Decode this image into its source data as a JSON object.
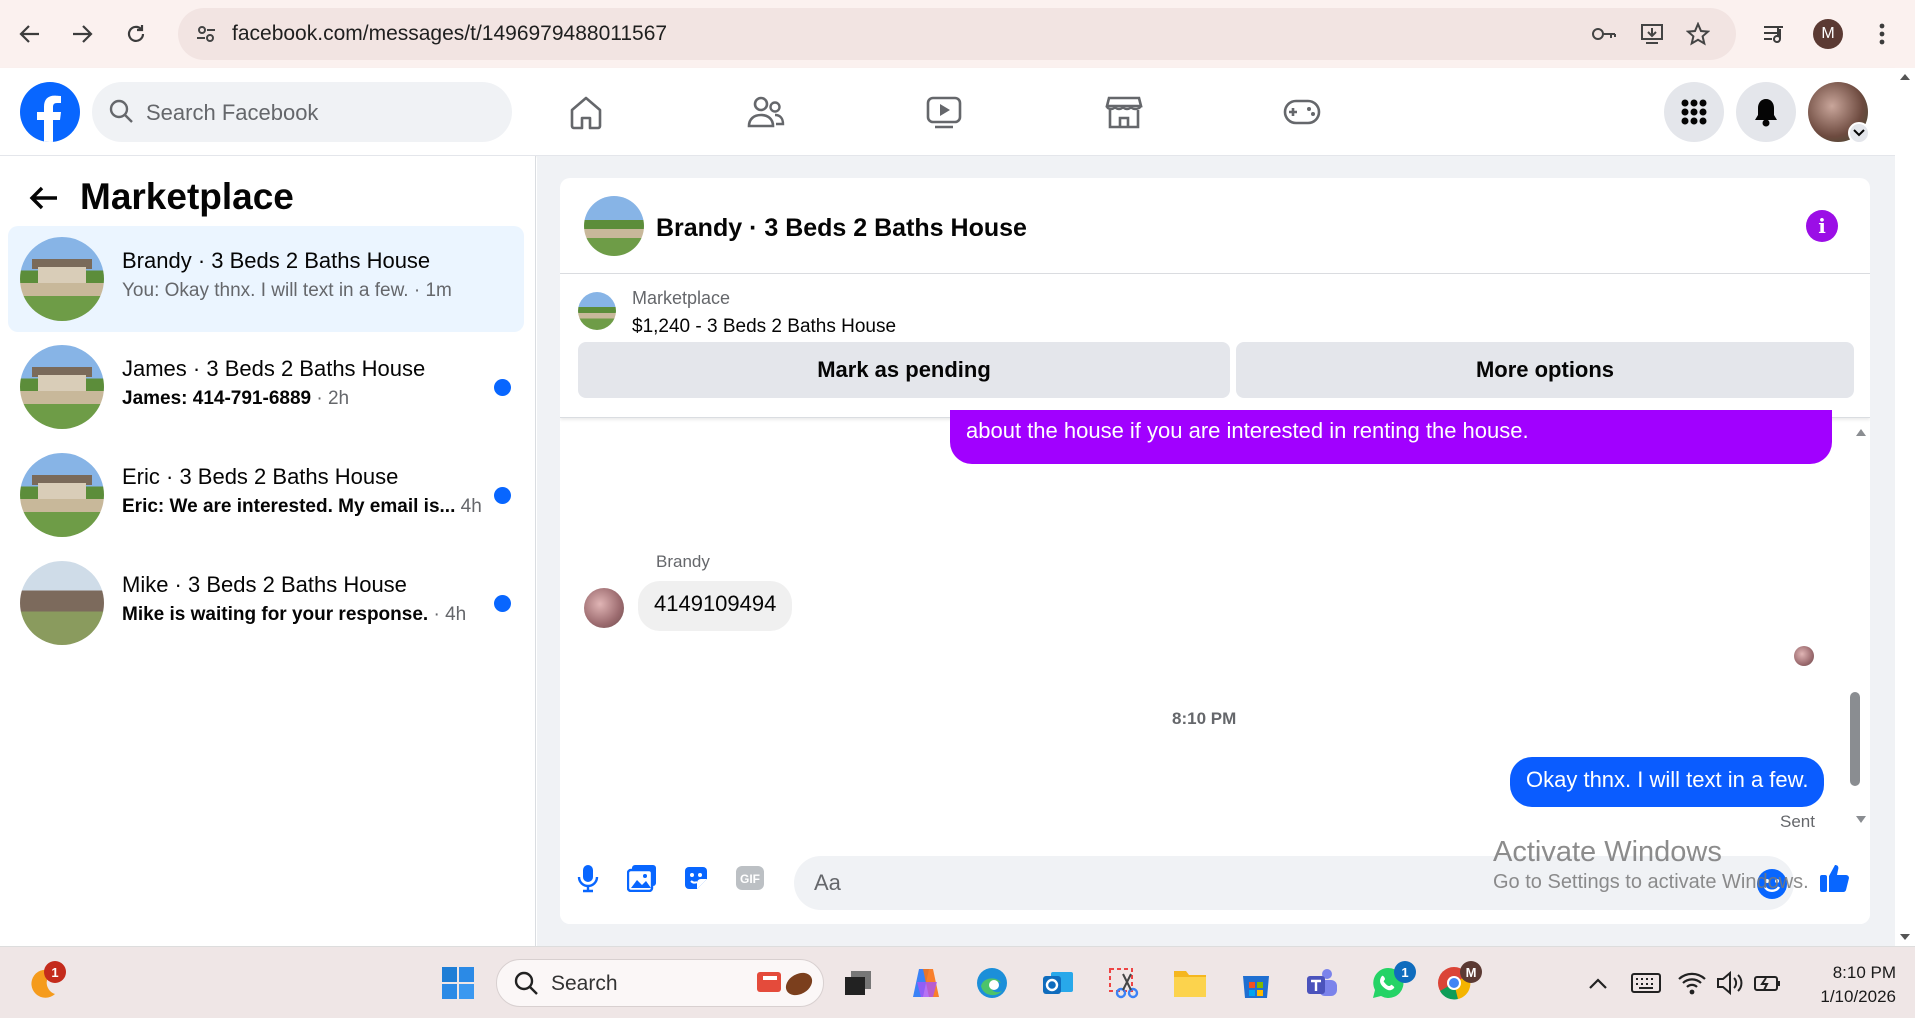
{
  "browser": {
    "url": "facebook.com/messages/t/1496979488011567",
    "profile_initial": "M"
  },
  "fb_header": {
    "search_placeholder": "Search Facebook"
  },
  "sidebar": {
    "title": "Marketplace",
    "conversations": [
      {
        "name": "Brandy · 3 Beds 2 Baths House",
        "snippet": "You: Okay thnx. I will text in a few.",
        "time": " · 1m",
        "unread": false,
        "active": true
      },
      {
        "name": "James · 3 Beds 2 Baths House",
        "snippet": "James: 414-791-6889",
        "time": " · 2h",
        "unread": true,
        "active": false
      },
      {
        "name": "Eric · 3 Beds 2 Baths House",
        "snippet": "Eric: We are interested. My email is...",
        "time": " 4h",
        "unread": true,
        "active": false
      },
      {
        "name": "Mike · 3 Beds 2 Baths House",
        "snippet": "Mike is waiting for your response.",
        "time": " · 4h",
        "unread": true,
        "active": false
      }
    ]
  },
  "chat": {
    "title": "Brandy · 3 Beds 2 Baths House",
    "marketplace_label": "Marketplace",
    "listing": "$1,240 - 3 Beds 2 Baths House",
    "mark_pending_label": "Mark as pending",
    "more_options_label": "More options",
    "messages": {
      "outgoing_partial": "about the house if you are interested in renting the house.",
      "incoming_sender": "Brandy",
      "incoming_text": "4149109494",
      "timestamp": "8:10 PM",
      "outgoing_text": "Okay thnx. I will text in a few.",
      "status": "Sent"
    },
    "composer_placeholder": "Aa"
  },
  "watermark": {
    "line1": "Activate Windows",
    "line2": "Go to Settings to activate Windows."
  },
  "taskbar": {
    "search_placeholder": "Search",
    "time": "8:10 PM",
    "date": "1/10/2026",
    "weather_badge": "1",
    "whatsapp_badge": "1",
    "chrome_badge": "M"
  },
  "colors": {
    "fb_blue": "#0866ff",
    "purple_bubble": "#a100ff",
    "blue_bubble": "#0a5cff",
    "active_conv": "#ebf5ff"
  }
}
